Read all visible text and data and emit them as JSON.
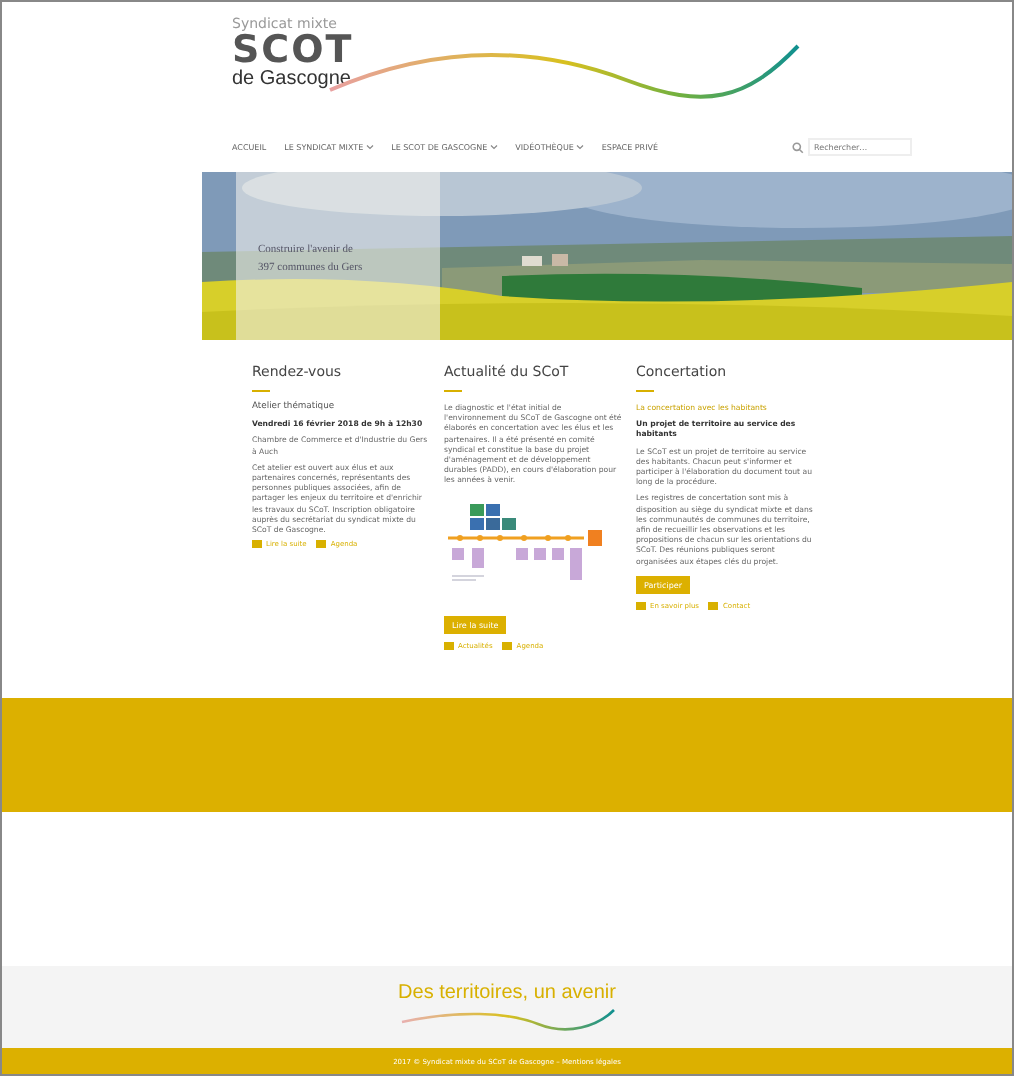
{
  "header": {
    "logo": {
      "small": "Syndicat mixte",
      "main": "SCOT",
      "sub": "de Gascogne"
    },
    "nav": [
      {
        "label": "ACCUEIL",
        "dropdown": false
      },
      {
        "label": "LE SYNDICAT MIXTE",
        "dropdown": true
      },
      {
        "label": "LE SCOT DE GASCOGNE",
        "dropdown": true
      },
      {
        "label": "VIDÉOTHÈQUE",
        "dropdown": true
      },
      {
        "label": "ESPACE PRIVÉ",
        "dropdown": false
      }
    ],
    "search": {
      "placeholder": "Rechercher…"
    }
  },
  "hero": {
    "caption_lines": [
      "Construire l'avenir de",
      "397 communes du Gers"
    ]
  },
  "columns": [
    {
      "title": "Rendez-vous",
      "paragraphs": [
        {
          "kind": "heading",
          "text": "Atelier thématique"
        },
        {
          "kind": "bold",
          "text": "Vendredi 16 février 2018 de 9h à 12h30"
        },
        {
          "kind": "text",
          "text": "Chambre de Commerce et d'Industrie du Gers à Auch"
        },
        {
          "kind": "text",
          "text": "Cet atelier est ouvert aux élus et aux partenaires concernés, représentants des personnes publiques associées, afin de partager les enjeux du territoire et d'enrichir les travaux du SCoT. Inscription obligatoire auprès du secrétariat du syndicat mixte du SCoT de Gascogne."
        }
      ],
      "links": [
        "Lire la suite",
        "Agenda"
      ]
    },
    {
      "title": "Actualité du SCoT",
      "diagram": {
        "kind": "timeline"
      },
      "paragraphs": [
        {
          "kind": "text",
          "text": "Le diagnostic et l'état initial de l'environnement du SCoT de Gascogne ont été élaborés en concertation avec les élus et les partenaires. Il a été présenté en comité syndical et constitue la base du projet d'aménagement et de développement durables (PADD), en cours d'élaboration pour les années à venir."
        }
      ],
      "button": "Lire la suite",
      "links": [
        "Actualités",
        "Agenda"
      ]
    },
    {
      "title": "Concertation",
      "paragraphs": [
        {
          "kind": "accent",
          "text": "La concertation avec les habitants"
        },
        {
          "kind": "bold",
          "text": "Un projet de territoire au service des habitants"
        },
        {
          "kind": "text",
          "text": "Le SCoT est un projet de territoire au service des habitants. Chacun peut s'informer et participer à l'élaboration du document tout au long de la procédure."
        },
        {
          "kind": "text",
          "text": "Les registres de concertation sont mis à disposition au siège du syndicat mixte et dans les communautés de communes du territoire, afin de recueillir les observations et les propositions de chacun sur les orientations du SCoT. Des réunions publiques seront organisées aux étapes clés du projet."
        }
      ],
      "button": "Participer",
      "links": [
        "En savoir plus",
        "Contact"
      ]
    }
  ],
  "footer": {
    "slogan": "Des territoires, un avenir",
    "copyright": "2017 © Syndicat mixte du SCoT de Gascogne – Mentions légales"
  }
}
